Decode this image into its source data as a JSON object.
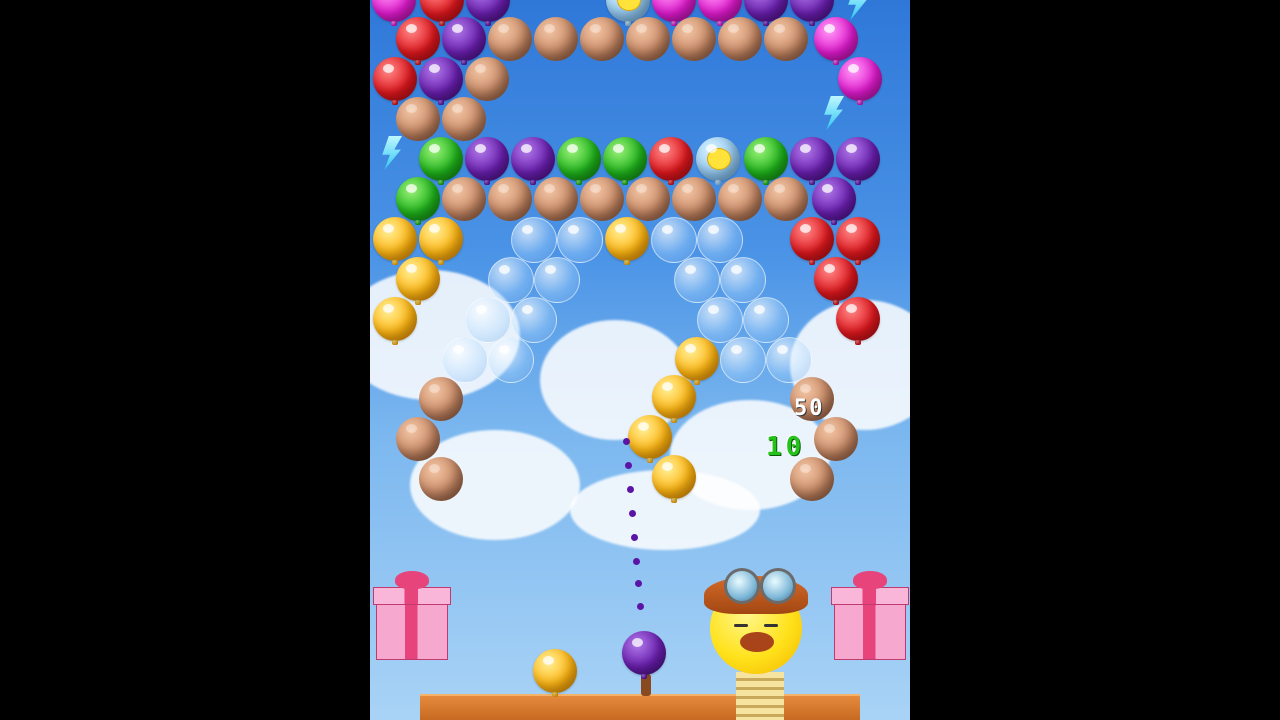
{
  "game": {
    "score_popups": {
      "green": "10",
      "white": "50"
    },
    "colors": {
      "red": "#e0181e",
      "purple": "#6a1fb0",
      "magenta": "#e21ad0",
      "green": "#1fb41b",
      "yellow": "#ffb612",
      "rock": "#c98a66"
    },
    "shooter": {
      "current": "purple",
      "next": "yellow"
    },
    "icons": [
      "bolt-icon",
      "gift-box-icon",
      "chick-pilot-icon",
      "aim-dots"
    ]
  }
}
